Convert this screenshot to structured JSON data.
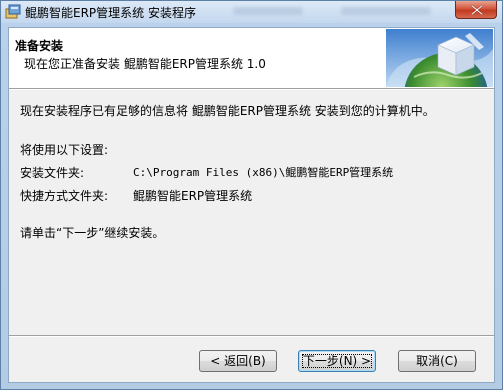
{
  "window": {
    "title": "鲲鹏智能ERP管理系统 安装程序",
    "icon": "installer-icon",
    "close_icon": "close-icon"
  },
  "header": {
    "title": "准备安装",
    "subtitle": "现在您正准备安装 鲲鹏智能ERP管理系统 1.0",
    "graphic": "globe-cube-icon"
  },
  "body": {
    "intro": "现在安装程序已有足够的信息将 鲲鹏智能ERP管理系统 安装到您的计算机中。",
    "settings_heading": "将使用以下设置:",
    "install_folder_label": "安装文件夹:",
    "install_folder_value": "C:\\Program Files (x86)\\鲲鹏智能ERP管理系统",
    "shortcut_folder_label": "快捷方式文件夹:",
    "shortcut_folder_value": "鲲鹏智能ERP管理系统",
    "continue_text": "请单击“下一步”继续安装。"
  },
  "buttons": {
    "back": "< 返回(B)",
    "next": "下一步(N) >",
    "cancel": "取消(C)"
  }
}
